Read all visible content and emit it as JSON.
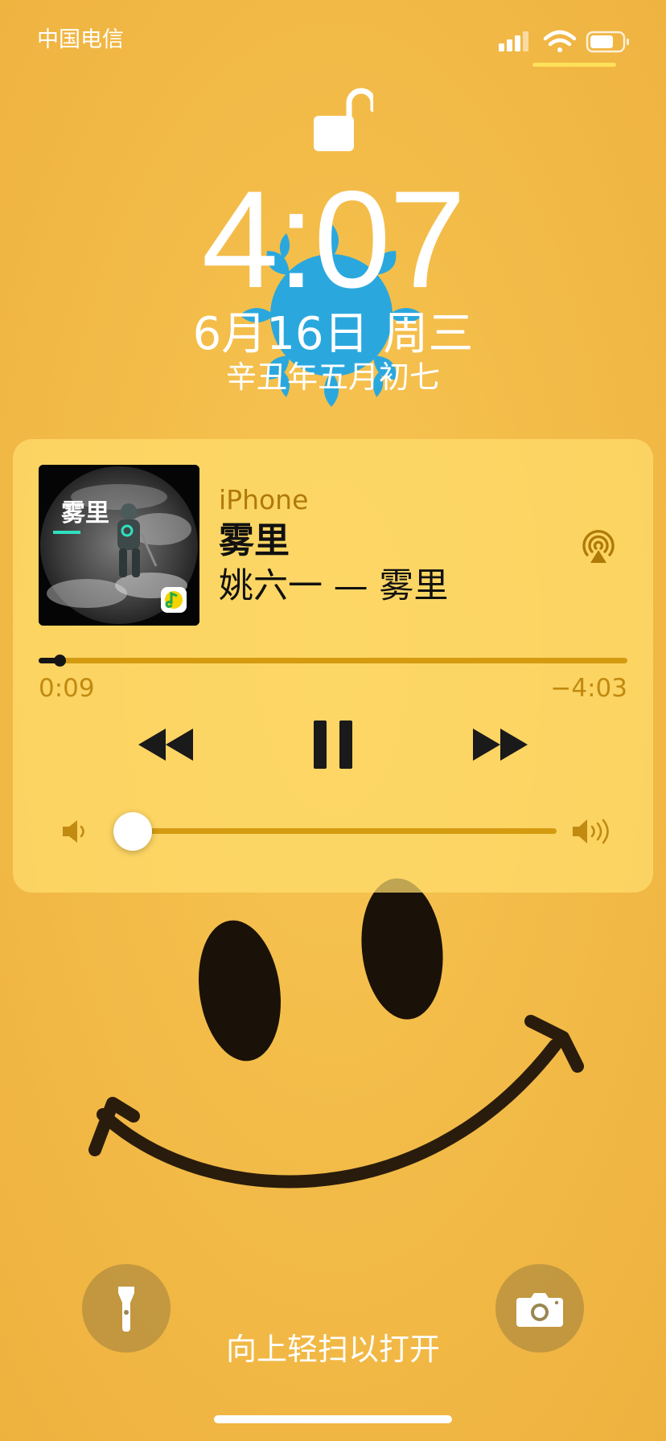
{
  "status_bar": {
    "carrier": "中国电信"
  },
  "lock_screen": {
    "time": "4:07",
    "date": "6月16日 周三",
    "lunar_date": "辛丑年五月初七"
  },
  "now_playing": {
    "output_device": "iPhone",
    "title": "雾里",
    "artist_album": "姚六一 — 雾里",
    "album_art_text": "雾里",
    "elapsed": "0:09",
    "remaining": "−4:03",
    "progress_fraction": 0.036,
    "volume_fraction": 0.02
  },
  "bottom": {
    "swipe_hint": "向上轻扫以打开"
  },
  "icons": {
    "lock": "unlocked-padlock-icon",
    "airplay": "airplay-icon",
    "rewind": "rewind-icon",
    "pause": "pause-icon",
    "fast_forward": "fast-forward-icon",
    "volume_low": "speaker-low-icon",
    "volume_high": "speaker-high-icon",
    "flashlight": "flashlight-icon",
    "camera": "camera-icon"
  },
  "colors": {
    "wallpaper": "#f0b844",
    "accent": "#d49b11",
    "route_label": "#b07a08",
    "sun": "#2aa8de"
  }
}
